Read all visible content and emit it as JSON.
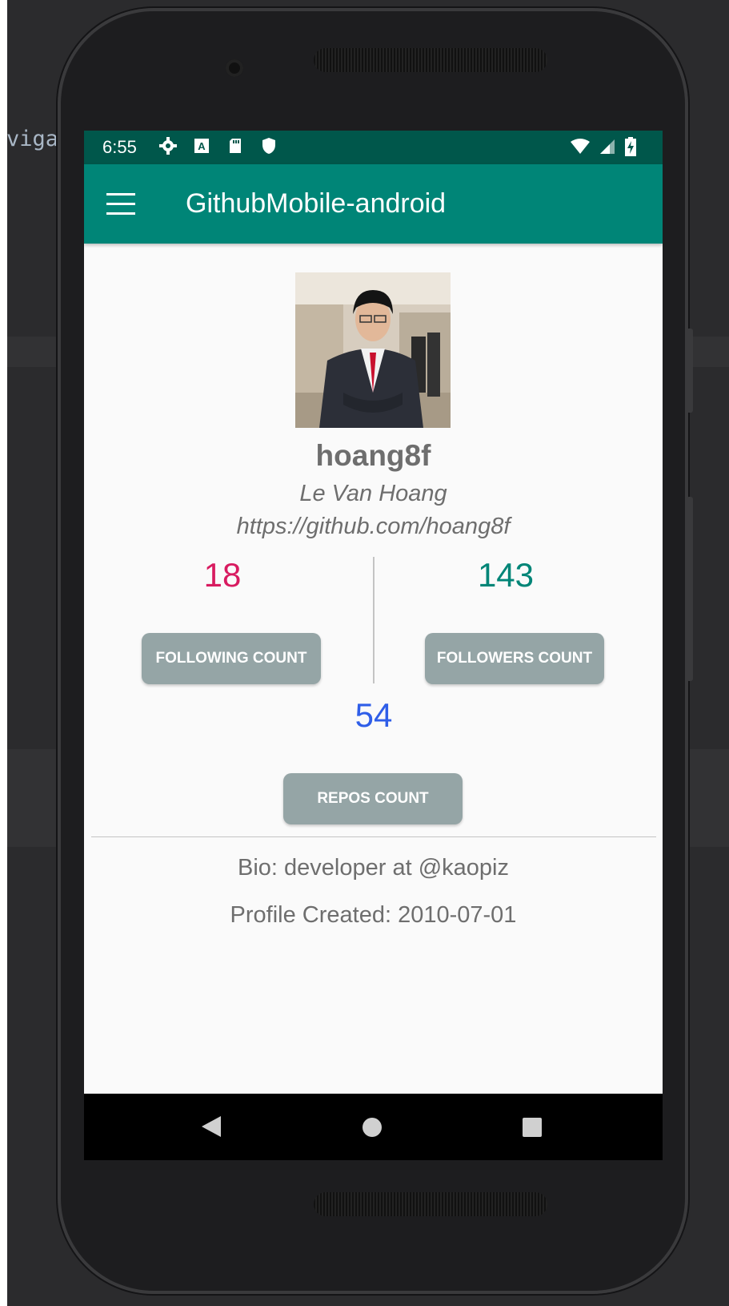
{
  "ide": {
    "snippet": "viga"
  },
  "status_bar": {
    "time": "6:55",
    "left_icons": [
      "settings-icon",
      "accessibility-a-icon",
      "sd-card-icon",
      "shield-icon"
    ],
    "right_icons": [
      "wifi-icon",
      "signal-icon",
      "battery-charging-icon"
    ]
  },
  "app_bar": {
    "title": "GithubMobile-android",
    "menu_icon": "hamburger-menu-icon"
  },
  "profile": {
    "username": "hoang8f",
    "full_name": "Le Van Hoang",
    "url": "https://github.com/hoang8f"
  },
  "stats": {
    "following": {
      "value": "18",
      "label": "FOLLOWING COUNT",
      "color": "#d81b60"
    },
    "followers": {
      "value": "143",
      "label": "FOLLOWERS COUNT",
      "color": "#008577"
    },
    "repos": {
      "value": "54",
      "label": "REPOS COUNT",
      "color": "#2f5ee8"
    }
  },
  "details": {
    "bio": "Bio: developer at @kaopiz",
    "created": "Profile Created: 2010-07-01"
  },
  "nav_bar": {
    "icons": [
      "back-icon",
      "home-icon",
      "recents-icon"
    ]
  },
  "colors": {
    "status_bar": "#00574b",
    "app_bar": "#008577",
    "button_bg": "#95a5a6"
  }
}
